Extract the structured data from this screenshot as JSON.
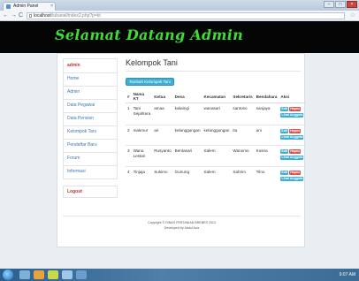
{
  "browser": {
    "tab_title": "Admin Panel",
    "tab_close": "×",
    "url_host": "localhost",
    "url_path": "/tubanel/index2.php?p=kt",
    "back": "←",
    "forward": "→",
    "reload": "C",
    "star": "☆",
    "window_buttons": [
      "–",
      "□",
      "×"
    ]
  },
  "header": {
    "title": "Selamat Datang Admin"
  },
  "sidebar": {
    "user": "admin",
    "items": [
      {
        "label": "Home"
      },
      {
        "label": "Admin"
      },
      {
        "label": "Data Pegawai"
      },
      {
        "label": "Data Pension"
      },
      {
        "label": "Kelompok Tani"
      },
      {
        "label": "Pendaftar Baru"
      },
      {
        "label": "Forum"
      },
      {
        "label": "Informasi"
      }
    ],
    "logout": "Logout"
  },
  "main": {
    "title": "Kelompok Tani",
    "add_button": "Tambah Kelompok Tani",
    "columns": [
      "#",
      "Nama KT",
      "Ketua",
      "Desa",
      "Kecamatan",
      "Sekretaris",
      "Bendahara",
      "Aksi"
    ],
    "rows": [
      [
        "1",
        "Tani Sejahtera",
        "amaa",
        "kalwingi",
        "wanasari",
        "santoso",
        "sanjaya"
      ],
      [
        "2",
        "makmur",
        "ari",
        "kelanggungan",
        "kelanggungan",
        "ita",
        "ani"
      ],
      [
        "3",
        "Wana Lestari",
        "Rusyanto",
        "Bentasari",
        "Salem",
        "Wanomo",
        "Kusna"
      ],
      [
        "4",
        "Tinjaja",
        "Sukimo",
        "Gunung",
        "Salem",
        "Sahrim",
        "Tilno"
      ]
    ],
    "actions": {
      "edit": "Edit",
      "delete": "Hapus",
      "view": "Lihat Anggota"
    }
  },
  "footer": {
    "line1": "Copyright © DINAS PERTANIAN BREBES 2013",
    "line2": "Developed by Abdul Aziz"
  },
  "taskbar": {
    "clock": "9:07 AM"
  },
  "colors": {
    "brand_green": "#3fdc36",
    "header_bg": "#050505",
    "accent_blue": "#3faed3",
    "danger_red": "#d9534f"
  }
}
